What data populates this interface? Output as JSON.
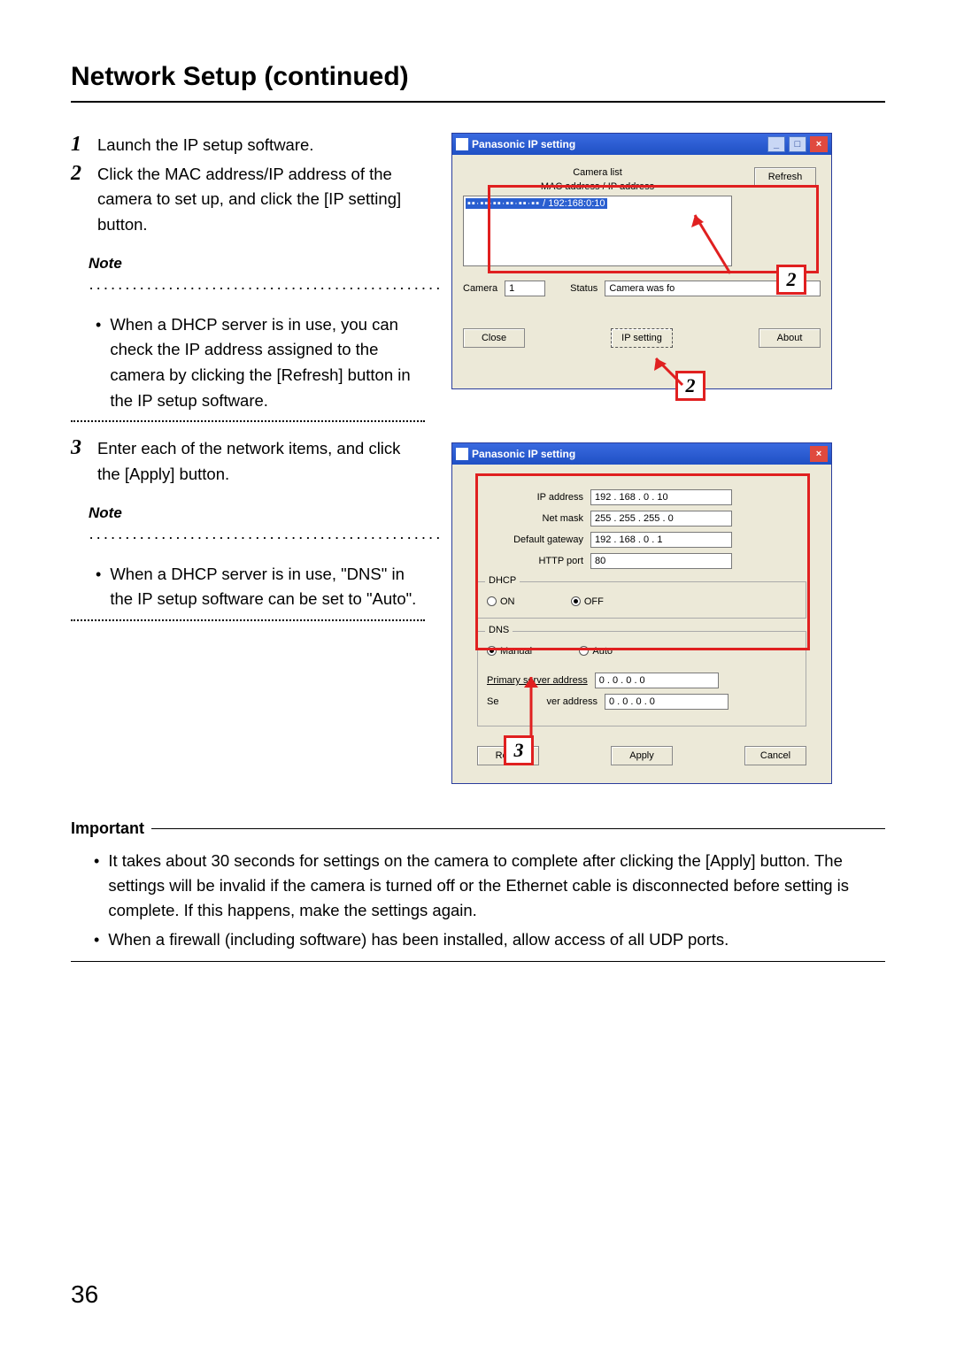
{
  "title": "Network Setup (continued)",
  "steps": {
    "s1": "Launch the IP setup software.",
    "s2": "Click the MAC address/IP address of the camera to set up, and click the [IP setting] button.",
    "s3": "Enter each of the network items, and click the [Apply] button."
  },
  "note_label": "Note",
  "note1": "When a DHCP server is in use, you can check the IP address assigned to the camera by clicking the [Refresh] button in the IP setup software.",
  "note2": "When a DHCP server is in use, \"DNS\" in the IP setup software can be set to \"Auto\".",
  "important_label": "Important",
  "important1": "It takes about 30 seconds for settings on the camera to complete after clicking the [Apply] button. The settings will be invalid if the camera is turned off or the Ethernet cable is disconnected before setting is complete. If this happens, make the settings again.",
  "important2": "When a firewall (including software) has been installed, allow access of all UDP ports.",
  "page_number": "36",
  "win1": {
    "title": "Panasonic IP setting",
    "camera_list_label": "Camera list",
    "mac_ip_label": "MAC address / IP address",
    "refresh": "Refresh",
    "list_entry": "/ 192:168:0:10",
    "camera_lbl": "Camera",
    "camera_val": "1",
    "status_lbl": "Status",
    "status_val": "Camera was fo",
    "close": "Close",
    "ip_setting": "IP setting",
    "about": "About"
  },
  "win2": {
    "title": "Panasonic IP setting",
    "ip_address_lbl": "IP address",
    "ip_address": "192 . 168 .  0  .  10",
    "net_mask_lbl": "Net mask",
    "net_mask": "255 . 255 . 255 .  0",
    "gateway_lbl": "Default gateway",
    "gateway": "192 . 168 .  0  .   1",
    "http_port_lbl": "HTTP port",
    "http_port": "80",
    "dhcp_label": "DHCP",
    "on": "ON",
    "off": "OFF",
    "dns_label": "DNS",
    "manual": "Manual",
    "auto": "Auto",
    "primary_lbl": "Primary server address",
    "primary": "0  .  0  .  0  .  0",
    "secondary_lbl": "ver address",
    "secondary_pre": "Se",
    "secondary": "0  .  0  .  0  .  0",
    "reset": "Reset",
    "apply": "Apply",
    "cancel": "Cancel"
  },
  "callout2": "2",
  "callout3": "3"
}
